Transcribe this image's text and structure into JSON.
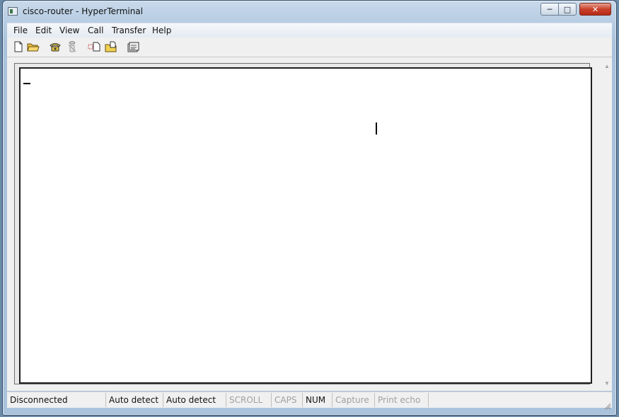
{
  "window": {
    "title": "cisco-router - HyperTerminal",
    "controls": {
      "minimize": "─",
      "maximize": "□",
      "close": "✕"
    }
  },
  "menu": [
    {
      "label": "File"
    },
    {
      "label": "Edit"
    },
    {
      "label": "View"
    },
    {
      "label": "Call"
    },
    {
      "label": "Transfer"
    },
    {
      "label": "Help"
    }
  ],
  "toolbar": {
    "buttons": [
      {
        "icon": "new-document-icon"
      },
      {
        "icon": "open-folder-icon"
      },
      {
        "icon": "phone-dial-icon"
      },
      {
        "icon": "phone-disconnect-icon"
      },
      {
        "icon": "send-file-icon"
      },
      {
        "icon": "receive-file-icon"
      },
      {
        "icon": "properties-icon"
      }
    ]
  },
  "status": {
    "connection": "Disconnected",
    "emulation": "Auto detect",
    "settings": "Auto detect",
    "scroll": "SCROLL",
    "caps": "CAPS",
    "num": "NUM",
    "capture": "Capture",
    "print_echo": "Print echo"
  },
  "colors": {
    "title_gradient": "#b7cde3",
    "close_button": "#c8402a",
    "dim_status": "#a0a0a0"
  }
}
